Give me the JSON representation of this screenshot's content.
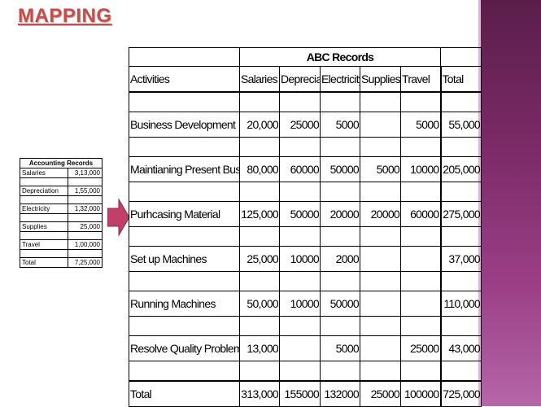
{
  "slide": {
    "title": "MAPPING"
  },
  "accounting": {
    "header": "Accounting Records",
    "rows": [
      {
        "label": "Salaries",
        "value": "3,13,000"
      },
      {
        "label": "Depreciation",
        "value": "1,55,000"
      },
      {
        "label": "Electricity",
        "value": "1,32,000"
      },
      {
        "label": "Supplies",
        "value": "25,000"
      },
      {
        "label": "Travel",
        "value": "1,00,000"
      },
      {
        "label": "Total",
        "value": "7,25,000"
      }
    ]
  },
  "abc": {
    "title": "ABC Records",
    "columns": [
      "Activities",
      "Salaries",
      "Depreciati",
      "Electricity",
      "Supplies",
      "Travel",
      "Total"
    ],
    "rows": [
      {
        "activity": "Business Development",
        "salaries": "20,000",
        "depreciation": "25000",
        "electricity": "5000",
        "supplies": "",
        "travel": "5000",
        "total": "55,000"
      },
      {
        "activity": "Maintianing Present Business",
        "salaries": "80,000",
        "depreciation": "60000",
        "electricity": "50000",
        "supplies": "5000",
        "travel": "10000",
        "total": "205,000"
      },
      {
        "activity": "Purhcasing Material",
        "salaries": "125,000",
        "depreciation": "50000",
        "electricity": "20000",
        "supplies": "20000",
        "travel": "60000",
        "total": "275,000"
      },
      {
        "activity": "Set up Machines",
        "salaries": "25,000",
        "depreciation": "10000",
        "electricity": "2000",
        "supplies": "",
        "travel": "",
        "total": "37,000"
      },
      {
        "activity": "Running Machines",
        "salaries": "50,000",
        "depreciation": "10000",
        "electricity": "50000",
        "supplies": "",
        "travel": "",
        "total": "110,000"
      },
      {
        "activity": "Resolve Quality Problems",
        "salaries": "13,000",
        "depreciation": "",
        "electricity": "5000",
        "supplies": "",
        "travel": "25000",
        "total": "43,000"
      }
    ],
    "total_row": {
      "activity": "Total",
      "salaries": "313,000",
      "depreciation": "155000",
      "electricity": "132000",
      "supplies": "25000",
      "travel": "100000",
      "total": "725,000"
    }
  },
  "colors": {
    "title": "#c0504d",
    "arrow": "#c0406a",
    "sidebar": "#7a2a66"
  }
}
